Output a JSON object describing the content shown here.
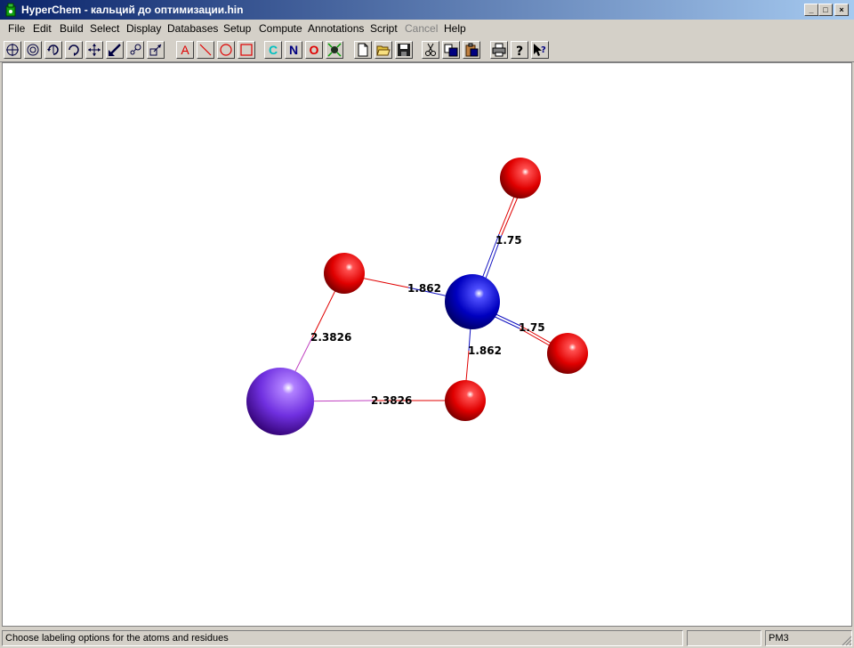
{
  "window": {
    "title": "HyperChem - кальций до оптимизации.hin",
    "controls": {
      "minimize": "_",
      "maximize": "□",
      "close": "×"
    }
  },
  "menu": {
    "file": "File",
    "edit": "Edit",
    "build": "Build",
    "select": "Select",
    "display": "Display",
    "databases": "Databases",
    "setup": "Setup",
    "compute": "Compute",
    "annotations": "Annotations",
    "script": "Script",
    "cancel": "Cancel",
    "help": "Help"
  },
  "toolbar": {
    "element_c": "C",
    "element_n": "N",
    "element_o": "O",
    "annotation_text": "A",
    "colors": {
      "c": "#00c0c0",
      "n": "#000080",
      "o": "#e00000",
      "annotation": "#e00000"
    }
  },
  "molecule": {
    "bond_labels": {
      "n_o_top": "1.75",
      "n_o_right": "1.75",
      "n_o_left": "1.862",
      "n_o_bottom": "1.862",
      "ca_o_left": "2.3826",
      "ca_o_bottom": "2.3826"
    },
    "colors": {
      "oxygen": "#ff0000",
      "nitrogen": "#0000c0",
      "calcium": "#8040ff",
      "ca_bond": "#c040c0"
    }
  },
  "status": {
    "message": "Choose labeling options for the atoms and residues",
    "method": "PM3"
  }
}
